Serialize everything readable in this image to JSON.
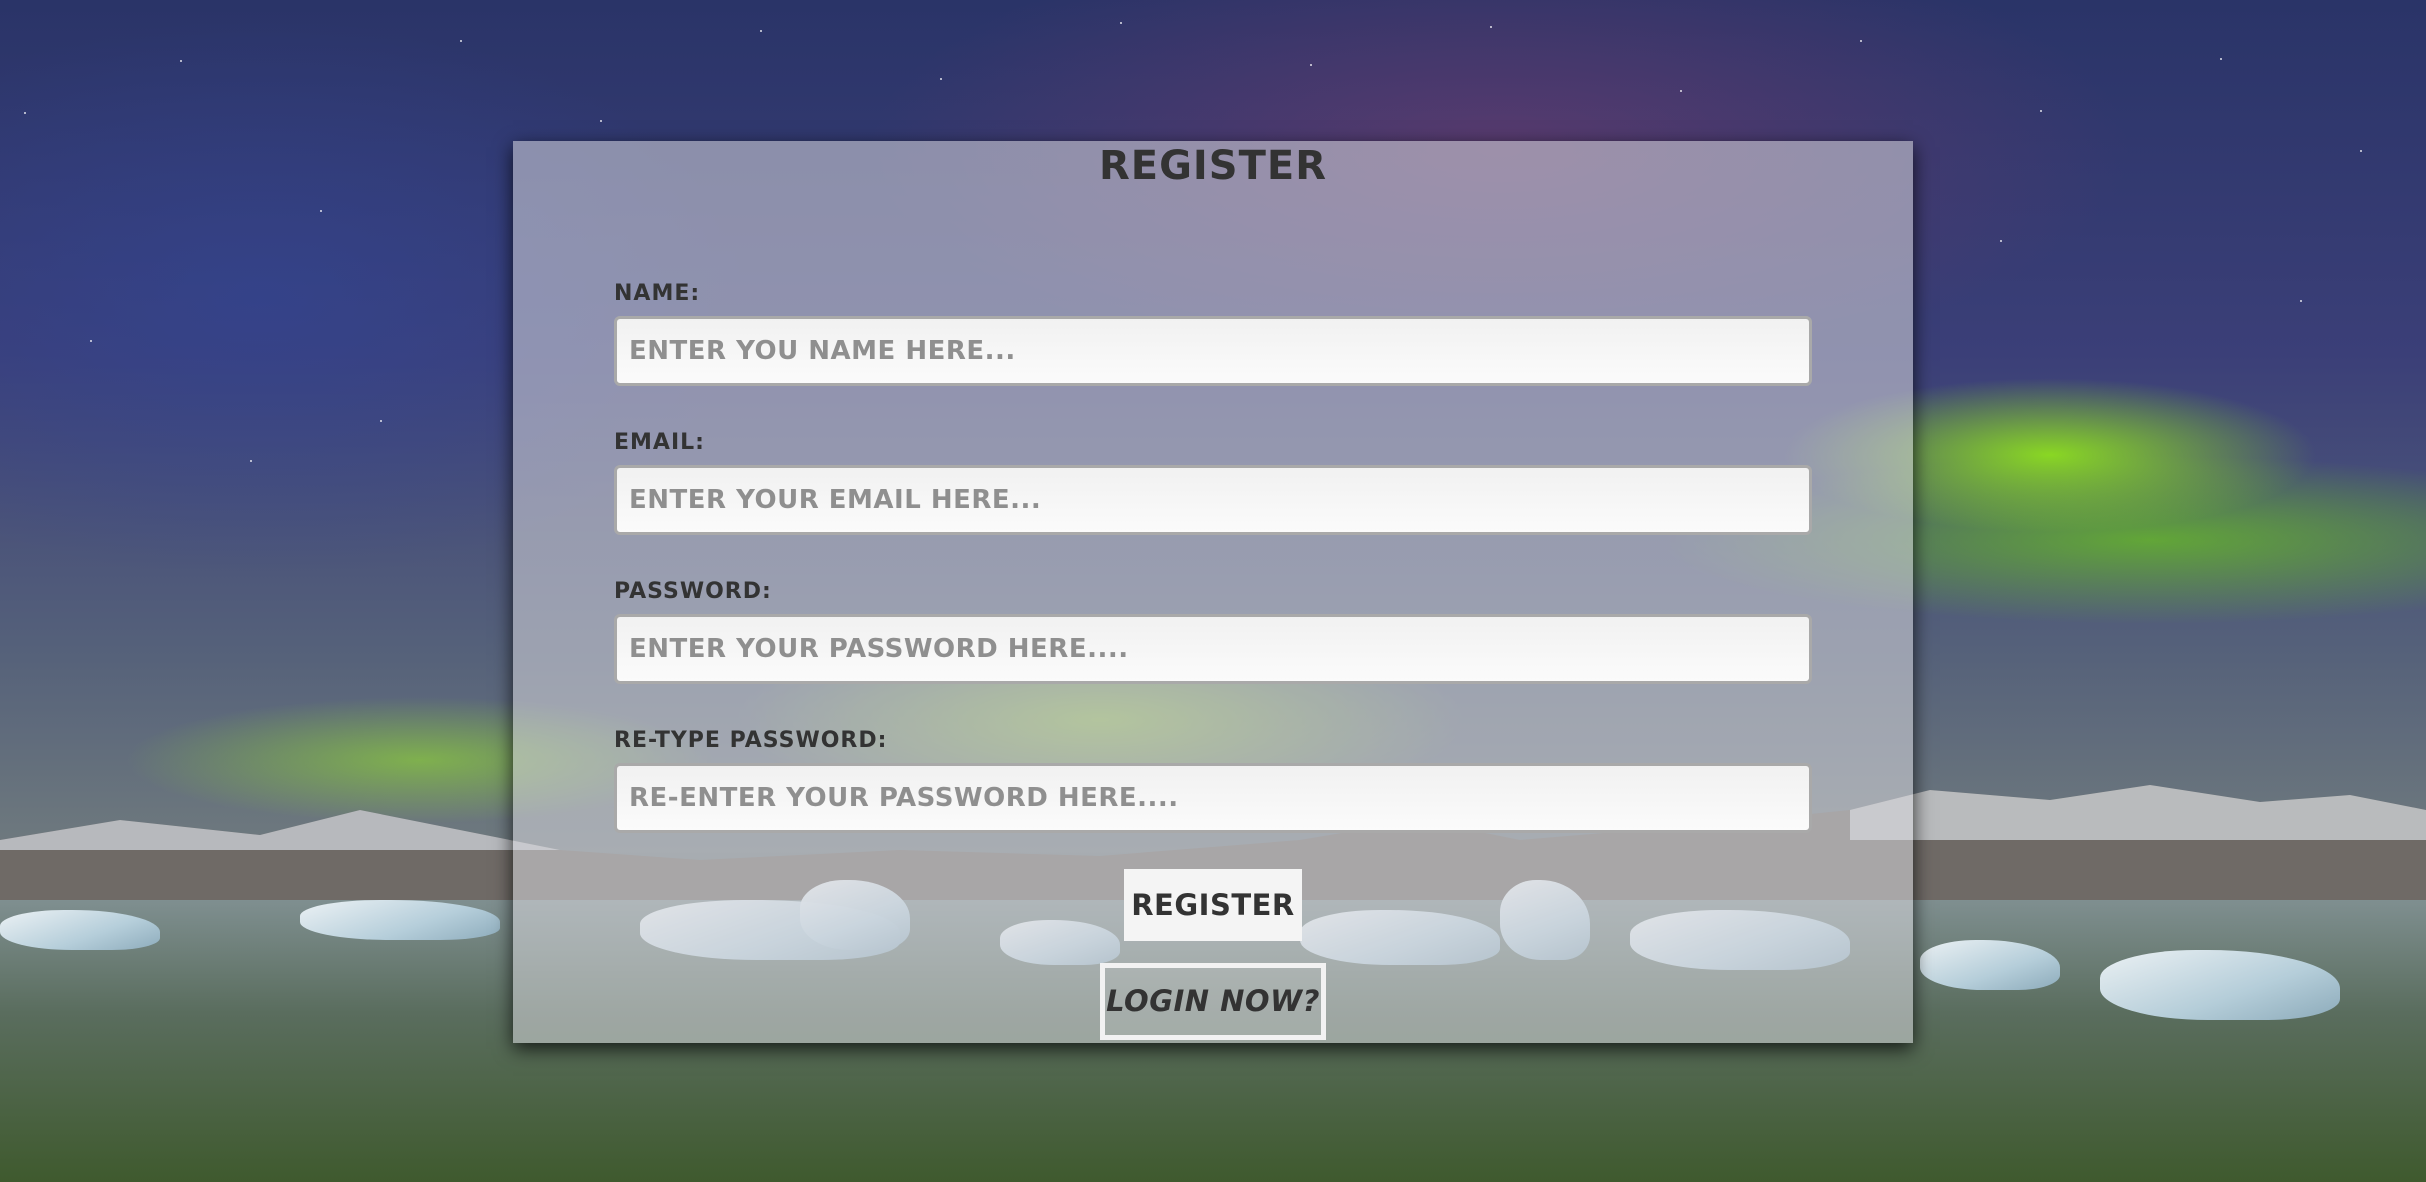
{
  "form": {
    "title": "REGISTER",
    "fields": [
      {
        "label": "NAME:",
        "placeholder": "ENTER YOU NAME HERE...",
        "value": ""
      },
      {
        "label": "EMAIL:",
        "placeholder": "ENTER YOUR EMAIL HERE...",
        "value": ""
      },
      {
        "label": "PASSWORD:",
        "placeholder": "ENTER YOUR PASSWORD HERE....",
        "value": ""
      },
      {
        "label": "RE-TYPE PASSWORD:",
        "placeholder": "RE-ENTER YOUR PASSWORD HERE....",
        "value": ""
      }
    ],
    "submit_label": "REGISTER",
    "login_link_label": "LOGIN NOW?"
  },
  "colors": {
    "panel_overlay": "#d7d7dc",
    "text": "#333333",
    "placeholder": "#8f8f8f",
    "button_bg": "#f4f4f4"
  }
}
